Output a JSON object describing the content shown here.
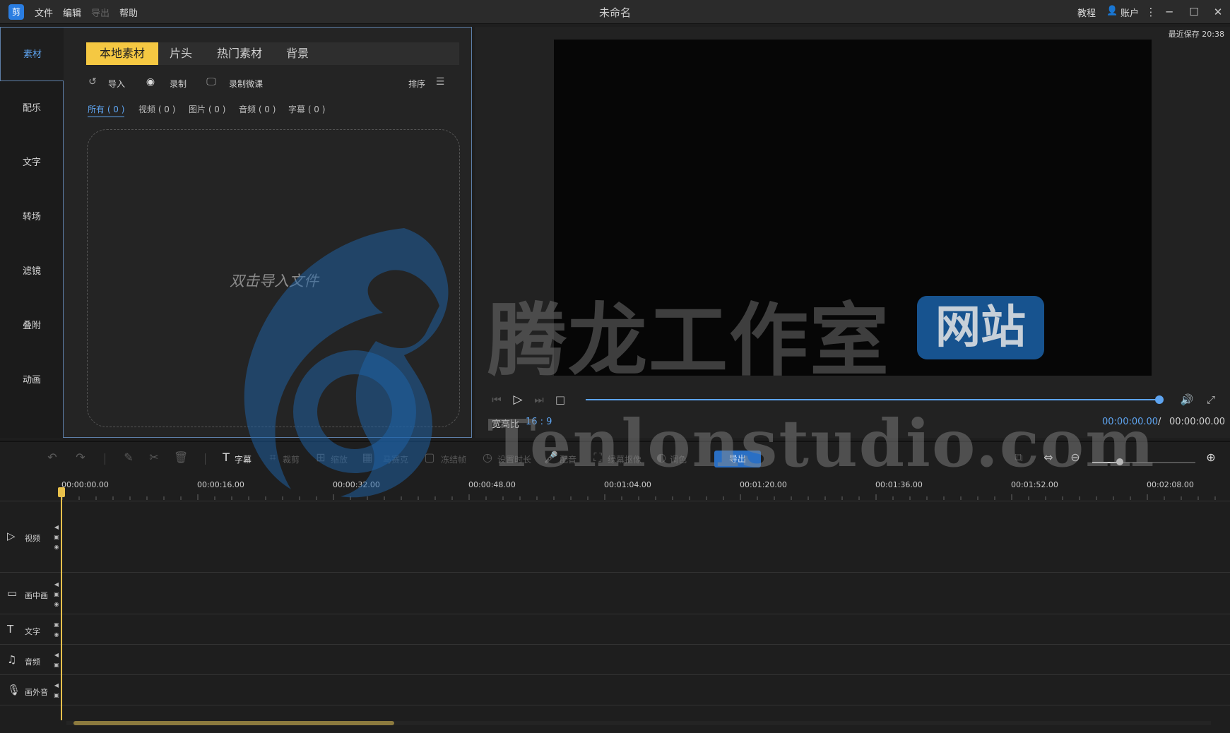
{
  "titlebar": {
    "logo": "剪",
    "menu": [
      "文件",
      "编辑",
      "导出",
      "帮助"
    ],
    "title": "未命名",
    "tutorial": "教程",
    "account": "账户"
  },
  "sidebar": {
    "items": [
      {
        "label": "素材",
        "active": true
      },
      {
        "label": "配乐"
      },
      {
        "label": "文字"
      },
      {
        "label": "转场"
      },
      {
        "label": "滤镜"
      },
      {
        "label": "叠附"
      },
      {
        "label": "动画"
      }
    ]
  },
  "material": {
    "tabs": [
      "本地素材",
      "片头",
      "热门素材",
      "背景"
    ],
    "actions": {
      "import": "导入",
      "record": "录制",
      "record_lesson": "录制微课",
      "sort": "排序"
    },
    "filters": [
      "所有 ( 0 )",
      "视频 ( 0 )",
      "图片 ( 0 )",
      "音频 ( 0 )",
      "字幕 ( 0 )"
    ],
    "dropzone_text": "双击导入文件"
  },
  "preview": {
    "autosave": "最近保存 20:38",
    "aspect_label": "宽高比",
    "aspect_value": "16 : 9",
    "time_current": "00:00:00.00",
    "time_sep": "/",
    "time_total": "00:00:00.00"
  },
  "toolbar": {
    "subtitle": "字幕",
    "crop": "裁剪",
    "zoom": "缩放",
    "mosaic": "马赛克",
    "freeze": "冻结帧",
    "duration": "设置时长",
    "voiceover": "配音",
    "green_screen": "绿幕抠像",
    "color": "调色",
    "export": "导出"
  },
  "timeline": {
    "ticks": [
      "00:00:00.00",
      "00:00:16.00",
      "00:00:32.00",
      "00:00:48.00",
      "00:01:04.00",
      "00:01:20.00",
      "00:01:36.00",
      "00:01:52.00",
      "00:02:08.00"
    ],
    "tracks": [
      {
        "label": "视频",
        "icon": "▷"
      },
      {
        "label": "画中画",
        "icon": "▭"
      },
      {
        "label": "文字",
        "icon": "T"
      },
      {
        "label": "音频",
        "icon": "♫"
      },
      {
        "label": "画外音",
        "icon": "🎙"
      }
    ]
  },
  "watermark": {
    "title": "腾龙工作室",
    "badge": "网站",
    "url": "Tenlonstudio.com"
  }
}
